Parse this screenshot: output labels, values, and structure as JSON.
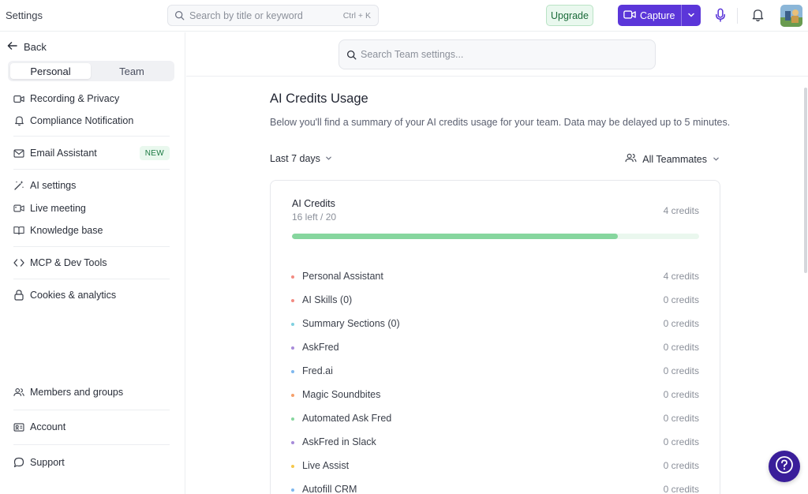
{
  "topbar": {
    "title": "Settings",
    "search_placeholder": "Search by title or keyword",
    "search_shortcut": "Ctrl + K",
    "upgrade_label": "Upgrade",
    "capture_label": "Capture",
    "colors": {
      "capture": "#5b36d9",
      "upgrade_bg": "#e9f8ee"
    }
  },
  "sidebar": {
    "back_label": "Back",
    "tabs": [
      {
        "label": "Personal",
        "active": true
      },
      {
        "label": "Team",
        "active": false
      }
    ],
    "items": [
      {
        "label": "Recording & Privacy",
        "icon": "video-camera-icon"
      },
      {
        "label": "Compliance Notification",
        "icon": "bell-icon"
      },
      {
        "label": "Email Assistant",
        "icon": "mail-icon",
        "badge": "NEW"
      },
      {
        "label": "AI settings",
        "icon": "magic-wand-icon"
      },
      {
        "label": "Live meeting",
        "icon": "meeting-camera-icon"
      },
      {
        "label": "Knowledge base",
        "icon": "book-icon"
      },
      {
        "label": "MCP & Dev Tools",
        "icon": "code-icon"
      },
      {
        "label": "Cookies & analytics",
        "icon": "lock-icon"
      },
      {
        "label": "Members and groups",
        "icon": "users-icon"
      },
      {
        "label": "Account",
        "icon": "id-card-icon"
      },
      {
        "label": "Support",
        "icon": "chat-bubble-icon"
      }
    ]
  },
  "main": {
    "search_placeholder": "Search Team settings...",
    "title": "AI Credits Usage",
    "description": "Below you'll find a summary of your AI credits usage for your team. Data may be delayed up to 5 minutes.",
    "period_filter": "Last 7 days",
    "teammate_filter": "All Teammates",
    "card": {
      "title": "AI Credits",
      "subtitle": "16 left / 20",
      "total": "4 credits",
      "used_fraction": 0.8,
      "progress_color": "#86d69e",
      "rows": [
        {
          "label": "Personal Assistant",
          "value": "4 credits",
          "color": "#f28b82"
        },
        {
          "label": "AI Skills (0)",
          "value": "0 credits",
          "color": "#f28b82"
        },
        {
          "label": "Summary Sections (0)",
          "value": "0 credits",
          "color": "#7fd0e0"
        },
        {
          "label": "AskFred",
          "value": "0 credits",
          "color": "#a78bda"
        },
        {
          "label": "Fred.ai",
          "value": "0 credits",
          "color": "#7fb8ee"
        },
        {
          "label": "Magic Soundbites",
          "value": "0 credits",
          "color": "#f5a06b"
        },
        {
          "label": "Automated Ask Fred",
          "value": "0 credits",
          "color": "#86d69e"
        },
        {
          "label": "AskFred in Slack",
          "value": "0 credits",
          "color": "#a78bda"
        },
        {
          "label": "Live Assist",
          "value": "0 credits",
          "color": "#f5c84c"
        },
        {
          "label": "Autofill CRM",
          "value": "0 credits",
          "color": "#7fb8ee"
        }
      ]
    }
  },
  "help": {
    "icon": "help-question-icon",
    "color": "#3a1e9a"
  }
}
